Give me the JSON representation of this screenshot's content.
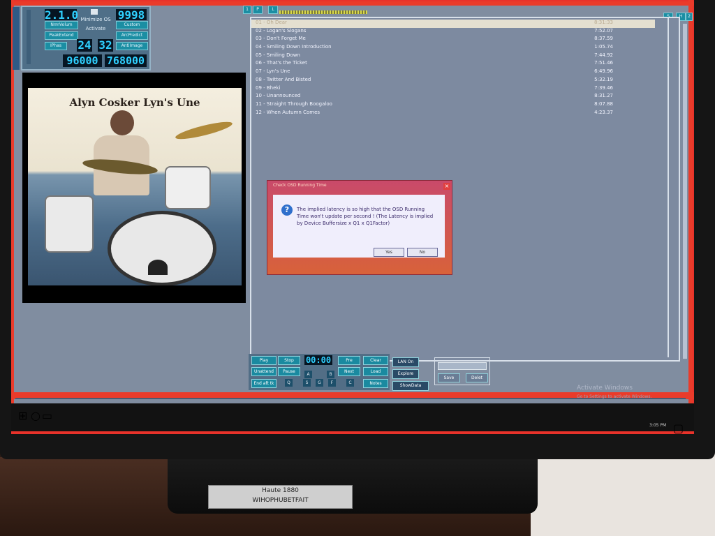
{
  "app": {
    "control_panel": {
      "display_left": "2.1.0",
      "display_right": "9998",
      "btn_normvolume": "NrmVolum",
      "btn_peakextend": "PeakExtend",
      "btn_iphase": "IPhas",
      "minimize_os": "Minimize OS",
      "activate": "Activate",
      "btn_custom": "Custom",
      "btn_arcpredict": "ArcPredict",
      "btn_antiimage": "AntiImage",
      "lcd_a": "24",
      "lcd_b": "32",
      "rate_left": "96000",
      "rate_right": "768000"
    },
    "tabs": {
      "p": "P",
      "l": "L",
      "s": "S",
      "h": "H",
      "two": "2",
      "x": "x"
    },
    "album": {
      "cover_text": "Alyn Cosker  Lyn's Une"
    },
    "playlist": [
      {
        "name": "01 - Oh Dear",
        "time": "8:31:33"
      },
      {
        "name": "02 - Logan's Slogans",
        "time": "7:52.07"
      },
      {
        "name": "03 - Don't Forget Me",
        "time": "8:37.59"
      },
      {
        "name": "04 - Smiling Down Introduction",
        "time": "1:05.74"
      },
      {
        "name": "05 - Smiling Down",
        "time": "7:44.92"
      },
      {
        "name": "06 - That's the Ticket",
        "time": "7:51.46"
      },
      {
        "name": "07 - Lyn's Une",
        "time": "6:49.96"
      },
      {
        "name": "08 - Twitter And Bisted",
        "time": "5:32.19"
      },
      {
        "name": "09 - Bheki",
        "time": "7:39.46"
      },
      {
        "name": "10 - Unannounced",
        "time": "8:31.27"
      },
      {
        "name": "11 - Straight Through Boogaloo",
        "time": "8:07.88"
      },
      {
        "name": "12 - When Autumn Comes",
        "time": "4:23.37"
      }
    ],
    "dialog": {
      "title": "Check OSD Running Time",
      "message": "The implied latency is so high that the OSD Running Time won't update per second ! (The Latency is implied by Device Buffersize x Q1 x Q1Factor)",
      "yes": "Yes",
      "no": "No"
    },
    "transport": {
      "play": "Play",
      "stop": "Stop",
      "time": "00:00",
      "prev": "Pre",
      "clear": "Clear",
      "unattend": "Unattend",
      "pause": "Pause",
      "next": "Next",
      "load": "Load",
      "endafter": "End aft tk",
      "notes": "Notes",
      "lan_on": "LAN On",
      "explore": "Explore",
      "showdata": "ShowData",
      "save": "Save",
      "delete": "Delet",
      "keys": [
        "Q",
        "S",
        "G",
        "F",
        "C",
        "A",
        "B"
      ]
    },
    "watermark": {
      "line1": "Activate Windows",
      "line2": "Go to Settings to activate Windows."
    },
    "taskbar": {
      "clock": "3:05 PM"
    }
  },
  "sticker": {
    "line1": "Haute 1880",
    "line2": "WIHOPHUBETFAIT"
  },
  "colors": {
    "accent_red": "#ea3b2a",
    "screen_bg": "#808da0",
    "button_teal": "#1a8aa0"
  }
}
